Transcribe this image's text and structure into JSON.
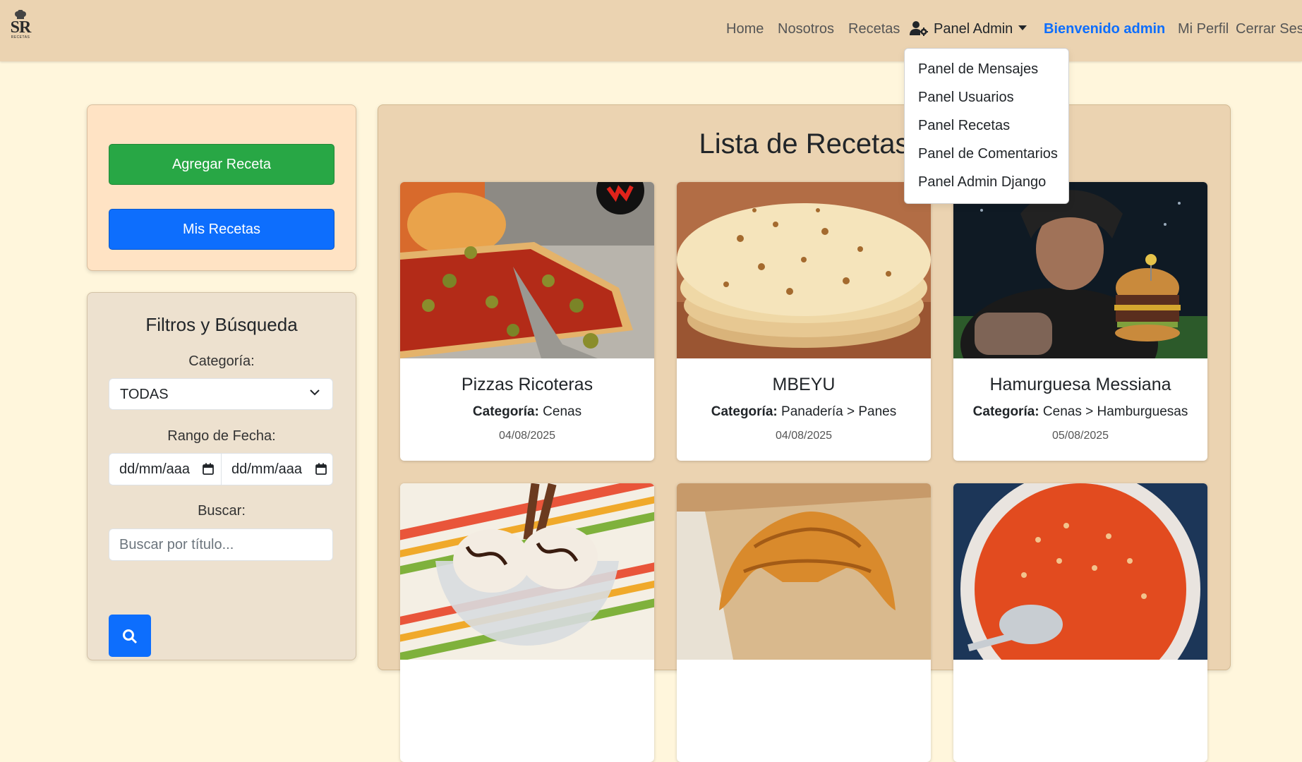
{
  "nav": {
    "logo_text": "SR",
    "logo_subtext": "RECETAS",
    "home": "Home",
    "nosotros": "Nosotros",
    "recetas": "Recetas",
    "panel_admin": "Panel Admin",
    "welcome": "Bienvenido admin",
    "mi_perfil": "Mi Perfil",
    "cerrar_sesion": "Cerrar Sesi"
  },
  "dropdown": {
    "items": [
      {
        "label": "Panel de Mensajes"
      },
      {
        "label": "Panel Usuarios"
      },
      {
        "label": "Panel Recetas"
      },
      {
        "label": "Panel de Comentarios"
      },
      {
        "label": "Panel Admin Django"
      }
    ]
  },
  "actions": {
    "add_recipe": "Agregar Receta",
    "my_recipes": "Mis Recetas"
  },
  "filters": {
    "title": "Filtros y Búsqueda",
    "category_label": "Categoría:",
    "category_value": "TODAS",
    "date_label": "Rango de Fecha:",
    "date_from_placeholder": "dd/mm/aaa",
    "date_to_placeholder": "dd/mm/aaa",
    "search_label": "Buscar:",
    "search_placeholder": "Buscar por título..."
  },
  "main": {
    "title": "Lista de Recetas",
    "category_prefix": "Categoría:",
    "recipes": [
      {
        "title": "Pizzas Ricoteras",
        "category": "Cenas",
        "date": "04/08/2025",
        "image": "pizza-photo"
      },
      {
        "title": "MBEYU",
        "category": "Panadería > Panes",
        "date": "04/08/2025",
        "image": "mbeyu-photo"
      },
      {
        "title": "Hamurguesa Messiana",
        "category": "Cenas > Hamburguesas",
        "date": "05/08/2025",
        "image": "burger-photo"
      },
      {
        "title": "",
        "category": "",
        "date": "",
        "image": "ice-cream-photo"
      },
      {
        "title": "",
        "category": "",
        "date": "",
        "image": "croissant-photo"
      },
      {
        "title": "",
        "category": "",
        "date": "",
        "image": "alphabet-soup-photo"
      }
    ]
  },
  "colors": {
    "navbar_bg": "#ebd3b1",
    "page_bg": "#fff6dc",
    "welcome": "#0d6efd",
    "btn_green": "#28a745",
    "btn_blue": "#0d6efd"
  }
}
